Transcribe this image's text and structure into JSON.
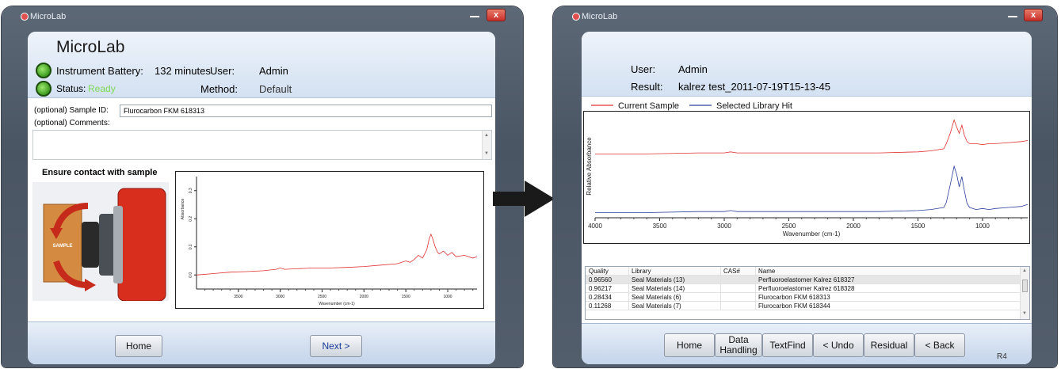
{
  "left_window": {
    "title": "MicroLab",
    "close_label": "x",
    "app_name": "MicroLab",
    "battery_label": "Instrument Battery:",
    "battery_value": "132 minutes",
    "user_label": "User:",
    "user_value": "Admin",
    "status_label": "Status:",
    "status_value": "Ready",
    "method_label": "Method:",
    "method_value": "Default",
    "sample_id_label": "(optional) Sample ID:",
    "sample_id_value": "Flurocarbon FKM 618313",
    "comments_label": "(optional) Comments:",
    "contact_heading": "Ensure contact with sample",
    "sample_block_label": "SAMPLE",
    "home_button": "Home",
    "next_button": "Next >",
    "status_color": "#7ed957",
    "chart_data": {
      "type": "line",
      "xlabel": "Wavenumber (cm-1)",
      "ylabel": "Absorbance",
      "x_ticks": [
        "3500",
        "3000",
        "2500",
        "2000",
        "1500",
        "1000"
      ],
      "y_ticks": [
        "0.0",
        "0.1",
        "0.2",
        "0.3"
      ],
      "xlim": [
        4000,
        650
      ],
      "ylim": [
        -0.05,
        0.35
      ],
      "series": [
        {
          "color": "#e03030",
          "x": [
            4000,
            3800,
            3600,
            3400,
            3200,
            3050,
            3000,
            2950,
            2800,
            2600,
            2400,
            2200,
            2000,
            1800,
            1600,
            1500,
            1450,
            1400,
            1350,
            1300,
            1250,
            1220,
            1200,
            1180,
            1150,
            1120,
            1100,
            1050,
            1000,
            950,
            900,
            800,
            700,
            650
          ],
          "y": [
            0.0,
            0.005,
            0.01,
            0.012,
            0.015,
            0.02,
            0.025,
            0.02,
            0.022,
            0.025,
            0.025,
            0.027,
            0.03,
            0.035,
            0.04,
            0.05,
            0.045,
            0.055,
            0.07,
            0.06,
            0.09,
            0.13,
            0.145,
            0.13,
            0.1,
            0.08,
            0.075,
            0.085,
            0.07,
            0.08,
            0.065,
            0.07,
            0.06,
            0.065
          ]
        }
      ]
    }
  },
  "right_window": {
    "title": "MicroLab",
    "close_label": "x",
    "user_label": "User:",
    "user_value": "Admin",
    "result_label": "Result:",
    "result_value": "kalrez test_2011-07-19T15-13-45",
    "home_button": "Home",
    "data_handling_button": "Data\nHandling",
    "textfind_button": "TextFind",
    "undo_button": "< Undo",
    "residual_button": "Residual",
    "back_button": "< Back",
    "version_label": "R4",
    "table": {
      "headers": [
        "Quality",
        "Library",
        "CAS#",
        "Name"
      ],
      "rows": [
        [
          "0.96560",
          "Seal Materials (13)",
          "",
          "Perfluoroelastomer Kalrez 618327"
        ],
        [
          "0.96217",
          "Seal Materials (14)",
          "",
          "Perfluoroelastomer Kalrez 618328"
        ],
        [
          "0.28434",
          "Seal Materials (6)",
          "",
          "Flurocarbon FKM 618313"
        ],
        [
          "0.11268",
          "Seal Materials (7)",
          "",
          "Flurocarbon FKM 618344"
        ]
      ]
    },
    "chart_data": {
      "type": "line",
      "xlabel": "Wavenumber (cm-1)",
      "ylabel": "Relative Absorbance",
      "x_ticks": [
        "4000",
        "3500",
        "3000",
        "2500",
        "2000",
        "1500",
        "1000"
      ],
      "xlim": [
        4000,
        650
      ],
      "series": [
        {
          "name": "Current Sample",
          "color": "#e03030",
          "x": [
            4000,
            3600,
            3200,
            3000,
            2950,
            2900,
            2600,
            2200,
            1800,
            1500,
            1400,
            1300,
            1280,
            1250,
            1220,
            1200,
            1180,
            1160,
            1140,
            1120,
            1100,
            1050,
            1000,
            950,
            900,
            800,
            700,
            650
          ],
          "y": [
            0.62,
            0.62,
            0.63,
            0.63,
            0.64,
            0.63,
            0.63,
            0.63,
            0.63,
            0.64,
            0.65,
            0.67,
            0.72,
            0.82,
            0.95,
            0.88,
            0.82,
            0.9,
            0.8,
            0.74,
            0.72,
            0.72,
            0.71,
            0.72,
            0.72,
            0.73,
            0.74,
            0.75
          ]
        },
        {
          "name": "Selected Library Hit",
          "color": "#2a3f9a",
          "x": [
            4000,
            3600,
            3200,
            3000,
            2950,
            2900,
            2600,
            2200,
            1800,
            1500,
            1400,
            1300,
            1280,
            1250,
            1220,
            1200,
            1180,
            1160,
            1140,
            1120,
            1100,
            1050,
            1000,
            950,
            900,
            800,
            700,
            650
          ],
          "y": [
            0.05,
            0.05,
            0.06,
            0.06,
            0.07,
            0.06,
            0.06,
            0.06,
            0.06,
            0.07,
            0.08,
            0.1,
            0.15,
            0.32,
            0.5,
            0.42,
            0.3,
            0.4,
            0.26,
            0.14,
            0.1,
            0.08,
            0.09,
            0.08,
            0.09,
            0.1,
            0.11,
            0.13
          ]
        }
      ]
    }
  }
}
